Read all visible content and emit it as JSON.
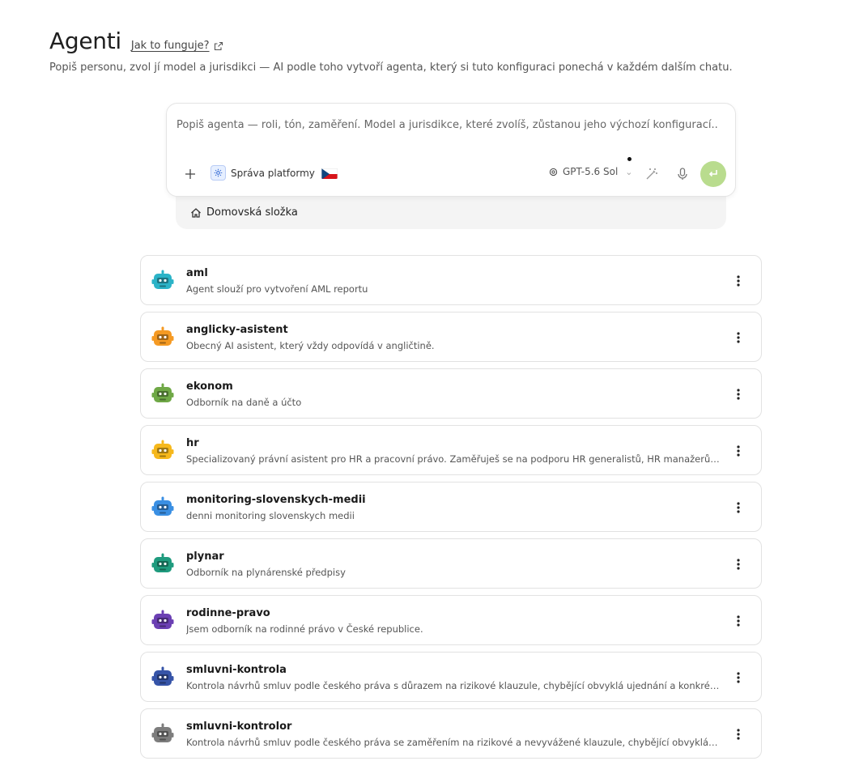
{
  "header": {
    "title": "Agenti",
    "howto_label": "Jak to funguje?",
    "subtitle": "Popiš personu, zvol jí model a jurisdikci — AI podle toho vytvoří agenta, který si tuto konfiguraci ponechá v každém dalším chatu."
  },
  "composer": {
    "placeholder": "Popiš agenta — roli, tón, zaměření. Model a jurisdikce, které zvolíš, zůstanou jeho výchozí konfigurací...",
    "value": "",
    "platform_label": "Správa platformy",
    "jurisdiction_flag": "czech-flag",
    "model_label": "GPT-5.6 Sol"
  },
  "folder": {
    "label": "Domovská složka"
  },
  "agents": [
    {
      "name": "aml",
      "description": "Agent slouží pro vytvoření AML reportu",
      "color": "#2bb3c7"
    },
    {
      "name": "anglicky-asistent",
      "description": "Obecný AI asistent, který vždy odpovídá v angličtině.",
      "color": "#f59a23"
    },
    {
      "name": "ekonom",
      "description": "Odborník na daně a účto",
      "color": "#6fa846"
    },
    {
      "name": "hr",
      "description": "Specializovaný právní asistent pro HR a pracovní právo. Zaměřuješ se na podporu HR generalistů, HR manažerů a interních týmů",
      "color": "#f6b81c"
    },
    {
      "name": "monitoring-slovenskych-medii",
      "description": "denni monitoring slovenskych medii",
      "color": "#3a8fe3"
    },
    {
      "name": "plynar",
      "description": "Odborník na plynárenské předpisy",
      "color": "#1f9b7e"
    },
    {
      "name": "rodinne-pravo",
      "description": "Jsem odborník na rodinné právo v České republice.",
      "color": "#6b3fb3"
    },
    {
      "name": "smluvni-kontrola",
      "description": "Kontrola návrhů smluv podle českého práva s důrazem na rizikové klauzule, chybějící obvyklá ujednání a konkrétní bezpečnostní",
      "color": "#3654a8"
    },
    {
      "name": "smluvni-kontrolor",
      "description": "Kontrola návrhů smluv podle českého práva se zaměřením na rizikové a nevyvážené klauzule, chybějící obvyklá ustanovení a",
      "color": "#7d7d7d"
    }
  ]
}
